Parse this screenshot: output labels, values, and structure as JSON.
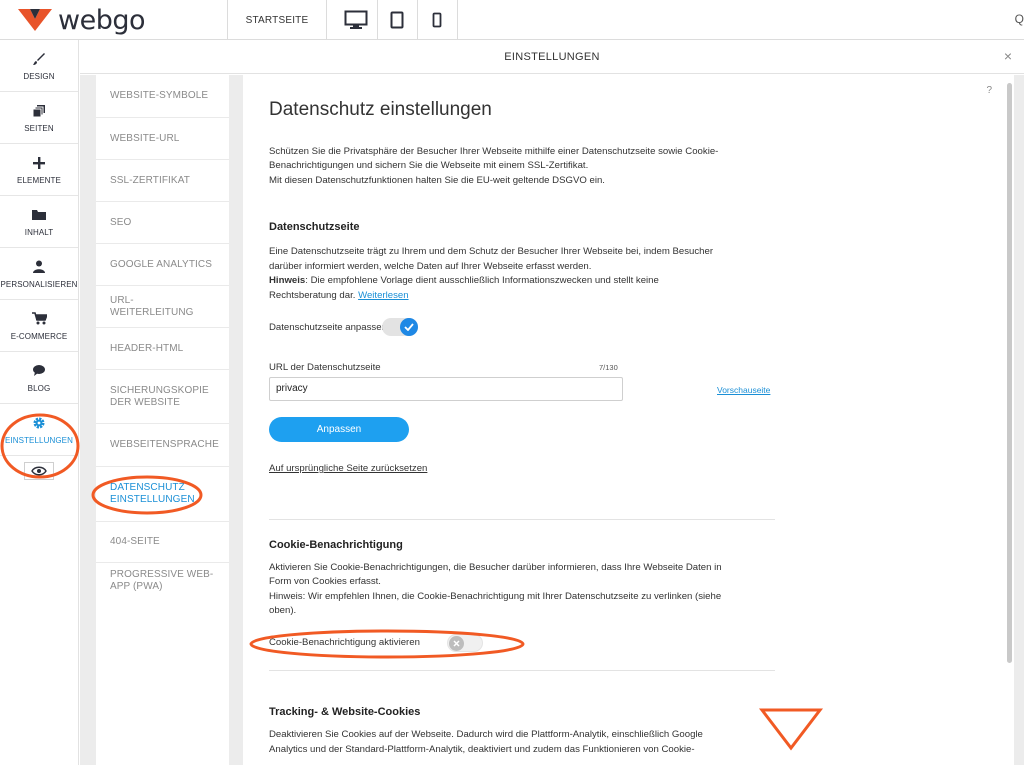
{
  "brand": {
    "name": "webgo",
    "accent": "#1a8fd6",
    "annotation_color": "#f15a24",
    "logo_color": "#e8542a"
  },
  "topbar": {
    "start_label": "STARTSEITE",
    "devices": [
      "desktop-icon",
      "tablet-icon",
      "mobile-icon"
    ],
    "right_glyph": "Q"
  },
  "sidebar": {
    "items": [
      {
        "label": "DESIGN",
        "icon": "brush-icon"
      },
      {
        "label": "SEITEN",
        "icon": "pages-icon"
      },
      {
        "label": "ELEMENTE",
        "icon": "plus-icon"
      },
      {
        "label": "INHALT",
        "icon": "folder-icon"
      },
      {
        "label": "PERSONALISIEREN",
        "icon": "person-icon"
      },
      {
        "label": "E-COMMERCE",
        "icon": "cart-icon"
      },
      {
        "label": "BLOG",
        "icon": "chat-icon"
      },
      {
        "label": "EINSTELLUNGEN",
        "icon": "gear-icon",
        "active": true
      }
    ],
    "extra_icon": "eye-icon"
  },
  "settings": {
    "title": "EINSTELLUNGEN",
    "close": "×",
    "nav": [
      {
        "label": "WEBSITE-SYMBOLE"
      },
      {
        "label": "WEBSITE-URL"
      },
      {
        "label": "SSL-ZERTIFIKAT"
      },
      {
        "label": "SEO"
      },
      {
        "label": "GOOGLE ANALYTICS"
      },
      {
        "label": "URL-WEITERLEITUNG"
      },
      {
        "label": "HEADER-HTML"
      },
      {
        "label": "SICHERUNGSKOPIE DER WEBSITE"
      },
      {
        "label": "WEBSEITENSPRACHE"
      },
      {
        "label": "DATENSCHUTZ EINSTELLUNGEN",
        "active": true
      },
      {
        "label": "404-SEITE"
      },
      {
        "label": "PROGRESSIVE WEB-APP (PWA)"
      }
    ]
  },
  "content": {
    "help": "?",
    "title": "Datenschutz einstellungen",
    "intro_1": "Schützen Sie die Privatsphäre der Besucher Ihrer Webseite mithilfe einer Datenschutzseite sowie Cookie-",
    "intro_2": "Benachrichtigungen und sichern Sie die Webseite mit einem SSL-Zertifikat.",
    "intro_3": "Mit diesen Datenschutzfunktionen halten Sie die EU-weit geltende DSGVO ein.",
    "privacy": {
      "heading": "Datenschutzseite",
      "text_1": "Eine Datenschutzseite trägt zu Ihrem und dem Schutz der Besucher Ihrer Webseite bei, indem Besucher",
      "text_2": "darüber informiert werden, welche Daten auf Ihrer Webseite erfasst werden.",
      "hint_label": "Hinweis",
      "hint_text": ": Die empfohlene Vorlage dient ausschließlich Informationszwecken und stellt keine",
      "hint_text_2": "Rechtsberatung dar.",
      "read_more": "Weiterlesen",
      "toggle_label": "Datenschutzseite anpassen",
      "toggle_on": true,
      "url_label": "URL der Datenschutzseite",
      "url_counter": "7/130",
      "url_value": "privacy",
      "preview_link": "Vorschauseite",
      "button": "Anpassen",
      "reset_link": "Auf ursprüngliche Seite zurücksetzen"
    },
    "cookie": {
      "heading": "Cookie-Benachrichtigung",
      "text_1": "Aktivieren Sie Cookie-Benachrichtigungen, die Besucher darüber informieren, dass Ihre Webseite Daten in",
      "text_2": "Form von Cookies erfasst.",
      "text_3": "Hinweis: Wir empfehlen Ihnen, die Cookie-Benachrichtigung mit Ihrer Datenschutzseite zu verlinken (siehe",
      "text_4": "oben).",
      "toggle_label": "Cookie-Benachrichtigung aktivieren",
      "toggle_on": false
    },
    "tracking": {
      "heading": "Tracking- & Website-Cookies",
      "text_1": "Deaktivieren Sie Cookies auf der Webseite. Dadurch wird die Plattform-Analytik, einschließlich Google",
      "text_2": "Analytics und der Standard-Plattform-Analytik, deaktiviert und zudem das Funktionieren von Cookie-"
    }
  }
}
